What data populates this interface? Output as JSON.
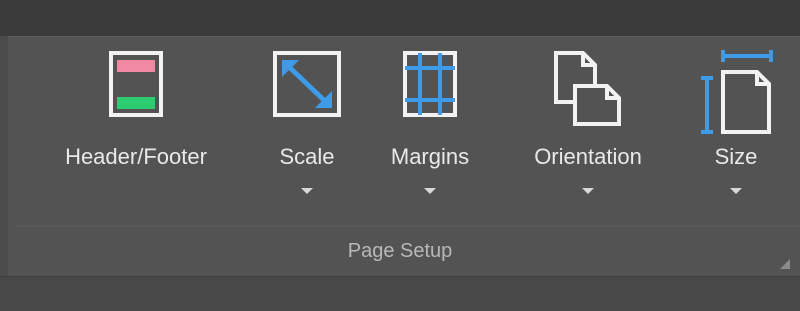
{
  "ribbon": {
    "group_label": "Page Setup",
    "buttons": [
      {
        "label": "Header/Footer",
        "icon": "header-footer-icon",
        "has_dropdown": false
      },
      {
        "label": "Scale",
        "icon": "scale-icon",
        "has_dropdown": true
      },
      {
        "label": "Margins",
        "icon": "margins-icon",
        "has_dropdown": true
      },
      {
        "label": "Orientation",
        "icon": "orientation-icon",
        "has_dropdown": true
      },
      {
        "label": "Size",
        "icon": "size-icon",
        "has_dropdown": true
      }
    ]
  },
  "colors": {
    "ribbon_bg": "#535353",
    "text": "#e9e9e9",
    "accent_blue": "#3d9be9",
    "header_pink": "#f08aa3",
    "footer_green": "#2ecc71",
    "outline": "#f2f2f2"
  }
}
